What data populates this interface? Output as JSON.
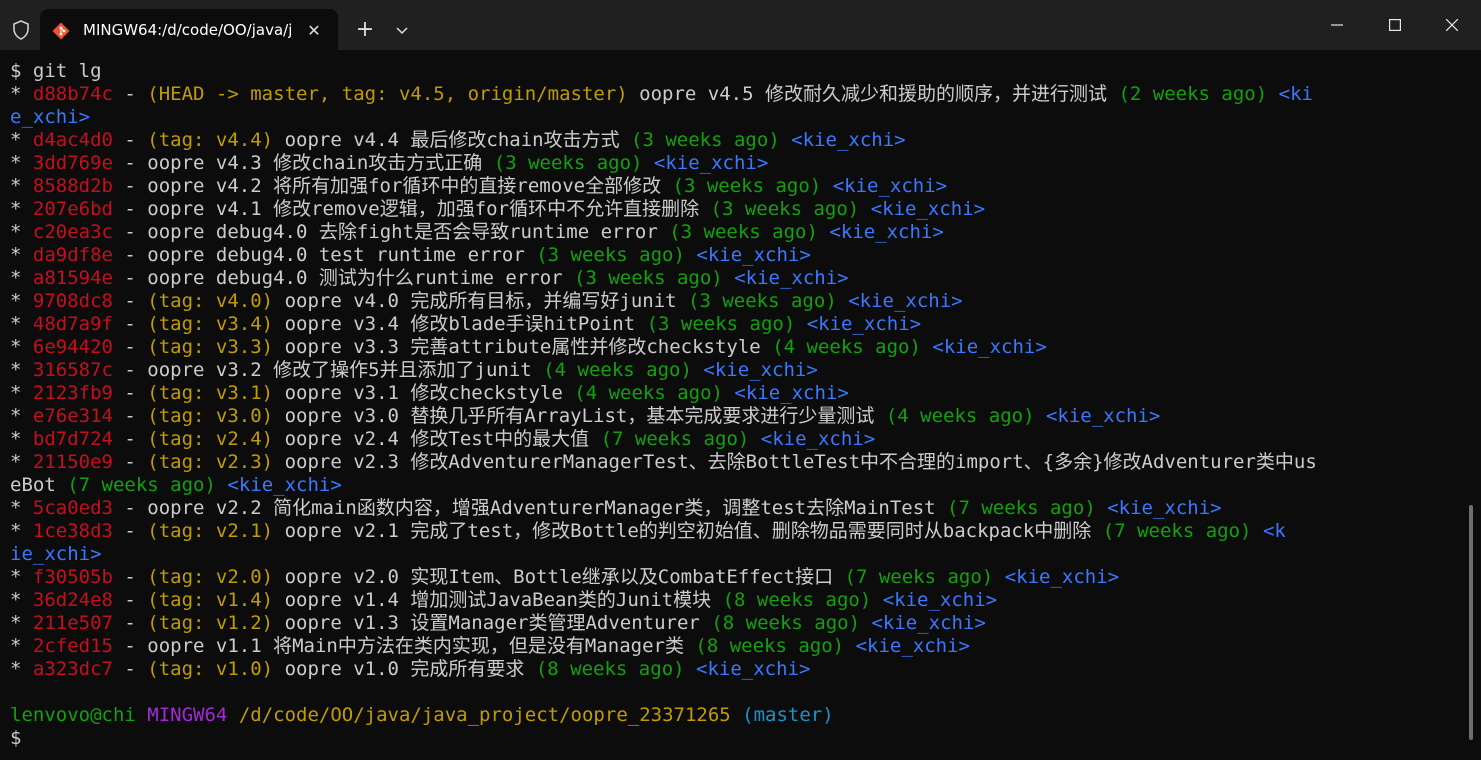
{
  "window": {
    "tab_title": "MINGW64:/d/code/OO/java/j",
    "icons": {
      "shield": "shield-icon",
      "tab": "git-bash-icon",
      "close": "close-icon",
      "new_tab": "plus-icon",
      "dropdown": "chevron-down-icon",
      "minimize": "minimize-icon",
      "maximize": "maximize-icon",
      "window_close": "window-close-icon"
    },
    "tab_close_glyph": "✕",
    "new_tab_glyph": "+"
  },
  "colors": {
    "background": "#0c0c0c",
    "titlebar": "#202020",
    "text": "#cccccc",
    "hash": "#c50f1f",
    "refs": "#c19c00",
    "date": "#13a10e",
    "author": "#3b78ff",
    "prompt_user": "#13a10e",
    "prompt_system": "#a12ad6",
    "prompt_path": "#c19c00",
    "prompt_branch": "#1d92c9"
  },
  "terminal": {
    "lines": [
      [
        {
          "c": "d",
          "t": "$ git lg"
        }
      ],
      [
        {
          "c": "d",
          "t": "* "
        },
        {
          "c": "h",
          "t": "d88b74c"
        },
        {
          "c": "d",
          "t": " - "
        },
        {
          "c": "r",
          "t": "(HEAD -> master, tag: v4.5, origin/master)"
        },
        {
          "c": "d",
          "t": " oopre v4.5 修改耐久减少和援助的顺序，并进行测试 "
        },
        {
          "c": "s",
          "t": "(2 weeks ago)"
        },
        {
          "c": "d",
          "t": " "
        },
        {
          "c": "a",
          "t": "<ki"
        }
      ],
      [
        {
          "c": "a",
          "t": "e_xchi>"
        }
      ],
      [
        {
          "c": "d",
          "t": "* "
        },
        {
          "c": "h",
          "t": "d4ac4d0"
        },
        {
          "c": "d",
          "t": " - "
        },
        {
          "c": "r",
          "t": "(tag: v4.4)"
        },
        {
          "c": "d",
          "t": " oopre v4.4 最后修改chain攻击方式 "
        },
        {
          "c": "s",
          "t": "(3 weeks ago)"
        },
        {
          "c": "d",
          "t": " "
        },
        {
          "c": "a",
          "t": "<kie_xchi>"
        }
      ],
      [
        {
          "c": "d",
          "t": "* "
        },
        {
          "c": "h",
          "t": "3dd769e"
        },
        {
          "c": "d",
          "t": " - oopre v4.3 修改chain攻击方式正确 "
        },
        {
          "c": "s",
          "t": "(3 weeks ago)"
        },
        {
          "c": "d",
          "t": " "
        },
        {
          "c": "a",
          "t": "<kie_xchi>"
        }
      ],
      [
        {
          "c": "d",
          "t": "* "
        },
        {
          "c": "h",
          "t": "8588d2b"
        },
        {
          "c": "d",
          "t": " - oopre v4.2 将所有加强for循环中的直接remove全部修改 "
        },
        {
          "c": "s",
          "t": "(3 weeks ago)"
        },
        {
          "c": "d",
          "t": " "
        },
        {
          "c": "a",
          "t": "<kie_xchi>"
        }
      ],
      [
        {
          "c": "d",
          "t": "* "
        },
        {
          "c": "h",
          "t": "207e6bd"
        },
        {
          "c": "d",
          "t": " - oopre v4.1 修改remove逻辑，加强for循环中不允许直接删除 "
        },
        {
          "c": "s",
          "t": "(3 weeks ago)"
        },
        {
          "c": "d",
          "t": " "
        },
        {
          "c": "a",
          "t": "<kie_xchi>"
        }
      ],
      [
        {
          "c": "d",
          "t": "* "
        },
        {
          "c": "h",
          "t": "c20ea3c"
        },
        {
          "c": "d",
          "t": " - oopre debug4.0 去除fight是否会导致runtime error "
        },
        {
          "c": "s",
          "t": "(3 weeks ago)"
        },
        {
          "c": "d",
          "t": " "
        },
        {
          "c": "a",
          "t": "<kie_xchi>"
        }
      ],
      [
        {
          "c": "d",
          "t": "* "
        },
        {
          "c": "h",
          "t": "da9df8e"
        },
        {
          "c": "d",
          "t": " - oopre debug4.0 test runtime error "
        },
        {
          "c": "s",
          "t": "(3 weeks ago)"
        },
        {
          "c": "d",
          "t": " "
        },
        {
          "c": "a",
          "t": "<kie_xchi>"
        }
      ],
      [
        {
          "c": "d",
          "t": "* "
        },
        {
          "c": "h",
          "t": "a81594e"
        },
        {
          "c": "d",
          "t": " - oopre debug4.0 测试为什么runtime error "
        },
        {
          "c": "s",
          "t": "(3 weeks ago)"
        },
        {
          "c": "d",
          "t": " "
        },
        {
          "c": "a",
          "t": "<kie_xchi>"
        }
      ],
      [
        {
          "c": "d",
          "t": "* "
        },
        {
          "c": "h",
          "t": "9708dc8"
        },
        {
          "c": "d",
          "t": " - "
        },
        {
          "c": "r",
          "t": "(tag: v4.0)"
        },
        {
          "c": "d",
          "t": " oopre v4.0 完成所有目标，并编写好junit "
        },
        {
          "c": "s",
          "t": "(3 weeks ago)"
        },
        {
          "c": "d",
          "t": " "
        },
        {
          "c": "a",
          "t": "<kie_xchi>"
        }
      ],
      [
        {
          "c": "d",
          "t": "* "
        },
        {
          "c": "h",
          "t": "48d7a9f"
        },
        {
          "c": "d",
          "t": " - "
        },
        {
          "c": "r",
          "t": "(tag: v3.4)"
        },
        {
          "c": "d",
          "t": " oopre v3.4 修改blade手误hitPoint "
        },
        {
          "c": "s",
          "t": "(3 weeks ago)"
        },
        {
          "c": "d",
          "t": " "
        },
        {
          "c": "a",
          "t": "<kie_xchi>"
        }
      ],
      [
        {
          "c": "d",
          "t": "* "
        },
        {
          "c": "h",
          "t": "6e94420"
        },
        {
          "c": "d",
          "t": " - "
        },
        {
          "c": "r",
          "t": "(tag: v3.3)"
        },
        {
          "c": "d",
          "t": " oopre v3.3 完善attribute属性并修改checkstyle "
        },
        {
          "c": "s",
          "t": "(4 weeks ago)"
        },
        {
          "c": "d",
          "t": " "
        },
        {
          "c": "a",
          "t": "<kie_xchi>"
        }
      ],
      [
        {
          "c": "d",
          "t": "* "
        },
        {
          "c": "h",
          "t": "316587c"
        },
        {
          "c": "d",
          "t": " - oopre v3.2 修改了操作5并且添加了junit "
        },
        {
          "c": "s",
          "t": "(4 weeks ago)"
        },
        {
          "c": "d",
          "t": " "
        },
        {
          "c": "a",
          "t": "<kie_xchi>"
        }
      ],
      [
        {
          "c": "d",
          "t": "* "
        },
        {
          "c": "h",
          "t": "2123fb9"
        },
        {
          "c": "d",
          "t": " - "
        },
        {
          "c": "r",
          "t": "(tag: v3.1)"
        },
        {
          "c": "d",
          "t": " oopre v3.1 修改checkstyle "
        },
        {
          "c": "s",
          "t": "(4 weeks ago)"
        },
        {
          "c": "d",
          "t": " "
        },
        {
          "c": "a",
          "t": "<kie_xchi>"
        }
      ],
      [
        {
          "c": "d",
          "t": "* "
        },
        {
          "c": "h",
          "t": "e76e314"
        },
        {
          "c": "d",
          "t": " - "
        },
        {
          "c": "r",
          "t": "(tag: v3.0)"
        },
        {
          "c": "d",
          "t": " oopre v3.0 替换几乎所有ArrayList，基本完成要求进行少量测试 "
        },
        {
          "c": "s",
          "t": "(4 weeks ago)"
        },
        {
          "c": "d",
          "t": " "
        },
        {
          "c": "a",
          "t": "<kie_xchi>"
        }
      ],
      [
        {
          "c": "d",
          "t": "* "
        },
        {
          "c": "h",
          "t": "bd7d724"
        },
        {
          "c": "d",
          "t": " - "
        },
        {
          "c": "r",
          "t": "(tag: v2.4)"
        },
        {
          "c": "d",
          "t": " oopre v2.4 修改Test中的最大值 "
        },
        {
          "c": "s",
          "t": "(7 weeks ago)"
        },
        {
          "c": "d",
          "t": " "
        },
        {
          "c": "a",
          "t": "<kie_xchi>"
        }
      ],
      [
        {
          "c": "d",
          "t": "* "
        },
        {
          "c": "h",
          "t": "21150e9"
        },
        {
          "c": "d",
          "t": " - "
        },
        {
          "c": "r",
          "t": "(tag: v2.3)"
        },
        {
          "c": "d",
          "t": " oopre v2.3 修改AdventurerManagerTest、去除BottleTest中不合理的import、{多余}修改Adventurer类中us"
        }
      ],
      [
        {
          "c": "d",
          "t": "eBot "
        },
        {
          "c": "s",
          "t": "(7 weeks ago)"
        },
        {
          "c": "d",
          "t": " "
        },
        {
          "c": "a",
          "t": "<kie_xchi>"
        }
      ],
      [
        {
          "c": "d",
          "t": "* "
        },
        {
          "c": "h",
          "t": "5ca0ed3"
        },
        {
          "c": "d",
          "t": " - oopre v2.2 简化main函数内容，增强AdventurerManager类，调整test去除MainTest "
        },
        {
          "c": "s",
          "t": "(7 weeks ago)"
        },
        {
          "c": "d",
          "t": " "
        },
        {
          "c": "a",
          "t": "<kie_xchi>"
        }
      ],
      [
        {
          "c": "d",
          "t": "* "
        },
        {
          "c": "h",
          "t": "1ce38d3"
        },
        {
          "c": "d",
          "t": " - "
        },
        {
          "c": "r",
          "t": "(tag: v2.1)"
        },
        {
          "c": "d",
          "t": " oopre v2.1 完成了test，修改Bottle的判空初始值、删除物品需要同时从backpack中删除 "
        },
        {
          "c": "s",
          "t": "(7 weeks ago)"
        },
        {
          "c": "d",
          "t": " "
        },
        {
          "c": "a",
          "t": "<k"
        }
      ],
      [
        {
          "c": "a",
          "t": "ie_xchi>"
        }
      ],
      [
        {
          "c": "d",
          "t": "* "
        },
        {
          "c": "h",
          "t": "f30505b"
        },
        {
          "c": "d",
          "t": " - "
        },
        {
          "c": "r",
          "t": "(tag: v2.0)"
        },
        {
          "c": "d",
          "t": " oopre v2.0 实现Item、Bottle继承以及CombatEffect接口 "
        },
        {
          "c": "s",
          "t": "(7 weeks ago)"
        },
        {
          "c": "d",
          "t": " "
        },
        {
          "c": "a",
          "t": "<kie_xchi>"
        }
      ],
      [
        {
          "c": "d",
          "t": "* "
        },
        {
          "c": "h",
          "t": "36d24e8"
        },
        {
          "c": "d",
          "t": " - "
        },
        {
          "c": "r",
          "t": "(tag: v1.4)"
        },
        {
          "c": "d",
          "t": " oopre v1.4 增加测试JavaBean类的Junit模块 "
        },
        {
          "c": "s",
          "t": "(8 weeks ago)"
        },
        {
          "c": "d",
          "t": " "
        },
        {
          "c": "a",
          "t": "<kie_xchi>"
        }
      ],
      [
        {
          "c": "d",
          "t": "* "
        },
        {
          "c": "h",
          "t": "211e507"
        },
        {
          "c": "d",
          "t": " - "
        },
        {
          "c": "r",
          "t": "(tag: v1.2)"
        },
        {
          "c": "d",
          "t": " oopre v1.3 设置Manager类管理Adventurer "
        },
        {
          "c": "s",
          "t": "(8 weeks ago)"
        },
        {
          "c": "d",
          "t": " "
        },
        {
          "c": "a",
          "t": "<kie_xchi>"
        }
      ],
      [
        {
          "c": "d",
          "t": "* "
        },
        {
          "c": "h",
          "t": "2cfed15"
        },
        {
          "c": "d",
          "t": " - oopre v1.1 将Main中方法在类内实现，但是没有Manager类 "
        },
        {
          "c": "s",
          "t": "(8 weeks ago)"
        },
        {
          "c": "d",
          "t": " "
        },
        {
          "c": "a",
          "t": "<kie_xchi>"
        }
      ],
      [
        {
          "c": "d",
          "t": "* "
        },
        {
          "c": "h",
          "t": "a323dc7"
        },
        {
          "c": "d",
          "t": " - "
        },
        {
          "c": "r",
          "t": "(tag: v1.0)"
        },
        {
          "c": "d",
          "t": " oopre v1.0 完成所有要求 "
        },
        {
          "c": "s",
          "t": "(8 weeks ago)"
        },
        {
          "c": "d",
          "t": " "
        },
        {
          "c": "a",
          "t": "<kie_xchi>"
        }
      ],
      [],
      [
        {
          "c": "s",
          "t": "lenvovo@chi"
        },
        {
          "c": "d",
          "t": " "
        },
        {
          "c": "pu",
          "t": "MINGW64"
        },
        {
          "c": "d",
          "t": " "
        },
        {
          "c": "r",
          "t": "/d/code/OO/java/java_project/oopre_23371265"
        },
        {
          "c": "d",
          "t": " "
        },
        {
          "c": "pb",
          "t": "(master)"
        }
      ],
      [
        {
          "c": "d",
          "t": "$"
        }
      ]
    ]
  }
}
